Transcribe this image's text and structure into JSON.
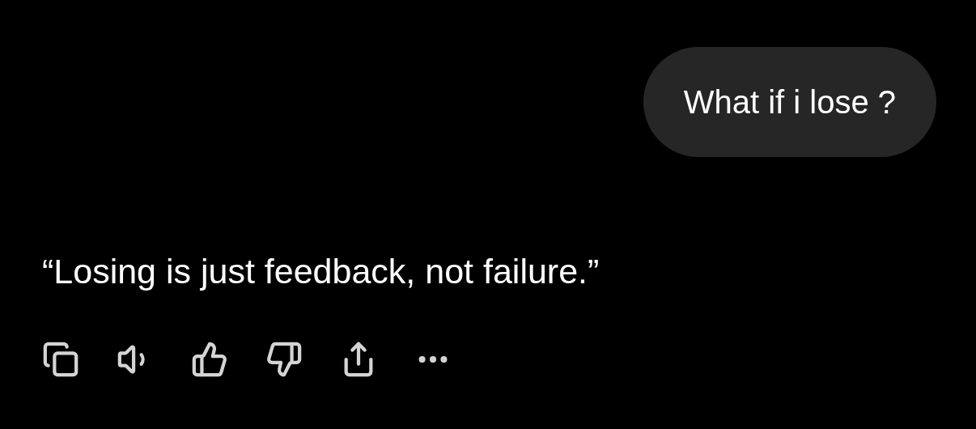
{
  "messages": [
    {
      "kind": "bubble",
      "text": "What if i lose ?"
    },
    {
      "kind": "reply",
      "text": "“Losing is just feedback, not failure.”"
    }
  ]
}
